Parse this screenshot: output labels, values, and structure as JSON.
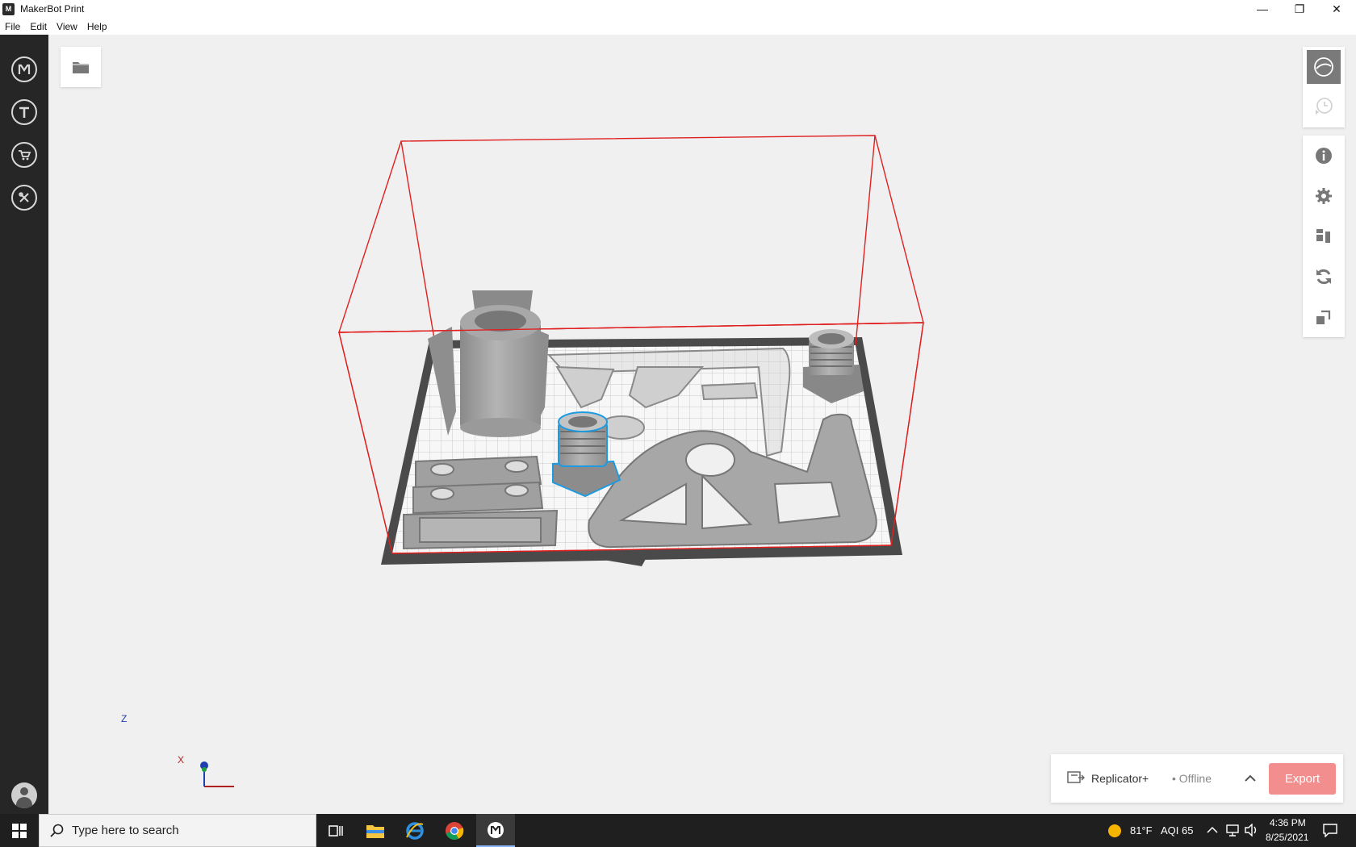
{
  "window": {
    "title": "MakerBot Print",
    "minimize": "—",
    "restore": "❐",
    "close": "✕"
  },
  "menu": [
    "File",
    "Edit",
    "View",
    "Help"
  ],
  "axis": {
    "z_label": "Z",
    "x_label": "X"
  },
  "printer": {
    "name": "Replicator+",
    "status": "• Offline",
    "export_label": "Export"
  },
  "taskbar": {
    "search_placeholder": "Type here to search",
    "weather": "81°F",
    "aqi": "AQI 65",
    "time": "4:36 PM",
    "date": "8/25/2021"
  },
  "colors": {
    "accent_export": "#f38e8e",
    "build_volume": "#e02020",
    "selection": "#1e9be0",
    "sidebar": "#262626"
  },
  "icons": {
    "sidebar": [
      "makerbot-logo-icon",
      "thingiverse-icon",
      "store-icon",
      "tools-icon"
    ],
    "right_toolbar": [
      "view-icon",
      "print-preview-icon",
      "info-icon",
      "settings-icon",
      "arrange-icon",
      "rotate-icon",
      "scale-icon"
    ]
  }
}
